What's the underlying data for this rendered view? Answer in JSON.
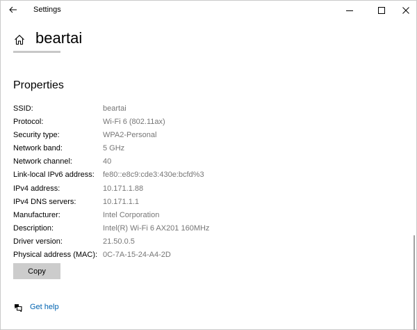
{
  "window": {
    "title": "Settings"
  },
  "header": {
    "network_name": "beartai"
  },
  "properties": {
    "title": "Properties",
    "rows": [
      {
        "label": "SSID:",
        "value": "beartai"
      },
      {
        "label": "Protocol:",
        "value": "Wi-Fi 6 (802.11ax)"
      },
      {
        "label": "Security type:",
        "value": "WPA2-Personal"
      },
      {
        "label": "Network band:",
        "value": "5 GHz"
      },
      {
        "label": "Network channel:",
        "value": "40"
      },
      {
        "label": "Link-local IPv6 address:",
        "value": "fe80::e8c9:cde3:430e:bcfd%3"
      },
      {
        "label": "IPv4 address:",
        "value": "10.171.1.88"
      },
      {
        "label": "IPv4 DNS servers:",
        "value": "10.171.1.1"
      },
      {
        "label": "Manufacturer:",
        "value": "Intel Corporation"
      },
      {
        "label": "Description:",
        "value": "Intel(R) Wi-Fi 6 AX201 160MHz"
      },
      {
        "label": "Driver version:",
        "value": "21.50.0.5"
      },
      {
        "label": "Physical address (MAC):",
        "value": "0C-7A-15-24-A4-2D"
      }
    ],
    "copy_label": "Copy"
  },
  "help": {
    "label": "Get help"
  },
  "icons": {
    "back": "back-arrow-icon",
    "minimize": "minimize-icon",
    "maximize": "maximize-icon",
    "close": "close-icon",
    "home": "home-icon",
    "help": "help-chat-icon"
  },
  "colors": {
    "link": "#0063b1",
    "value_text": "#767676",
    "button_bg": "#cccccc"
  }
}
